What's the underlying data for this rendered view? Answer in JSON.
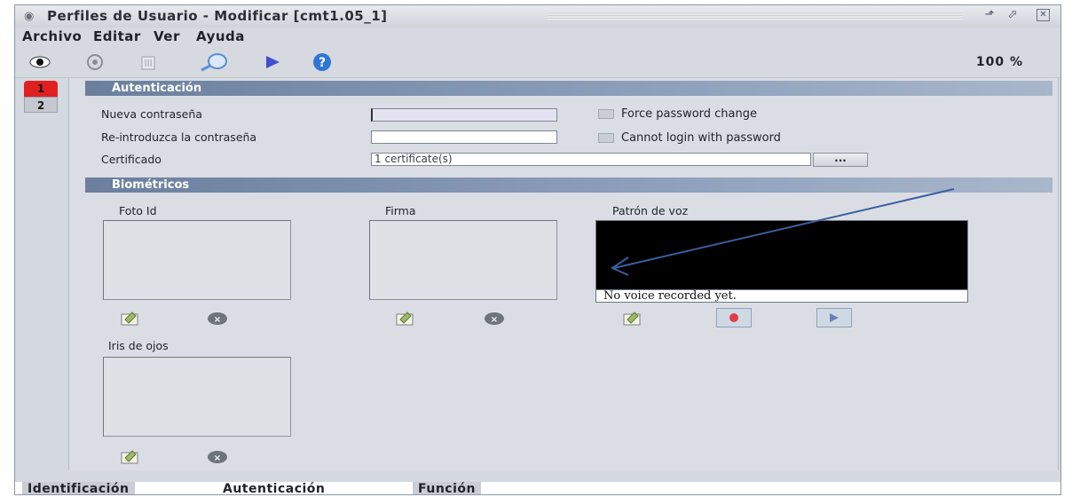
{
  "window": {
    "title": "Perfiles de Usuario - Modificar [cmt1.05_1]",
    "app_icon": "eye-app-icon"
  },
  "menu": [
    "Archivo",
    "Editar",
    "Ver",
    "Ayuda"
  ],
  "toolbar": {
    "icons": [
      "eye-icon",
      "refresh-icon",
      "trash-icon",
      "search-icon",
      "play-icon",
      "help-icon"
    ],
    "zoom": "100 %"
  },
  "side_tabs": [
    "1",
    "2"
  ],
  "auth": {
    "header": "Autenticación",
    "new_password_label": "Nueva contraseña",
    "new_password_value": "",
    "repeat_password_label": "Re-introduzca la contraseña",
    "repeat_password_value": "",
    "certificate_label": "Certificado",
    "certificate_value": "1 certificate(s)",
    "browse_label": "...",
    "force_change_label": "Force password change",
    "cannot_login_label": "Cannot login with password"
  },
  "bio": {
    "header": "Biométricos",
    "photo_label": "Foto Id",
    "signature_label": "Firma",
    "voice_label": "Patrón de voz",
    "voice_status": "No voice recorded yet.",
    "iris_label": "Iris de ojos"
  },
  "bottom_tabs": [
    "Identificación",
    "Autenticación",
    "Función"
  ],
  "colors": {
    "active_tab": "#e02020",
    "section_header": "#6b7f9e",
    "annotation_arrow": "#3b5fa0"
  }
}
